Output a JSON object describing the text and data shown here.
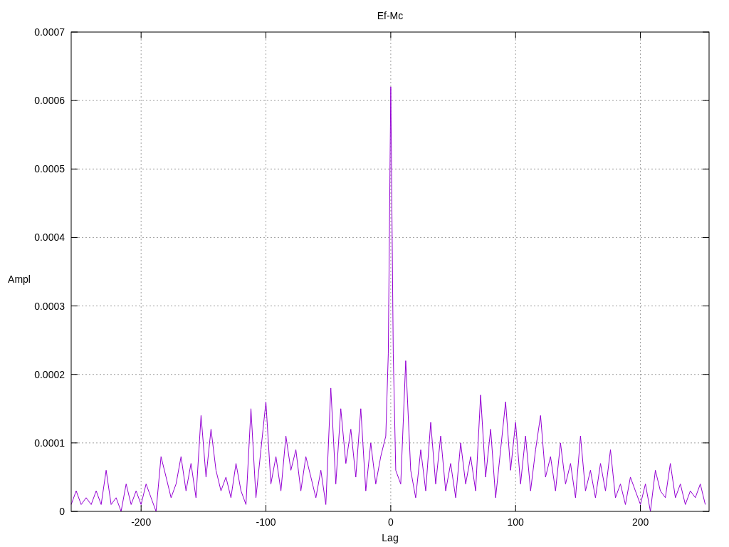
{
  "chart_data": {
    "type": "line",
    "title": "Ef-Mc",
    "xlabel": "Lag",
    "ylabel": "Ampl",
    "grid": true,
    "xlim": [
      -256,
      255
    ],
    "ylim": [
      0,
      0.0007
    ],
    "xticks": [
      -200,
      -100,
      0,
      100,
      200
    ],
    "yticks": [
      {
        "value": 0,
        "label": "0"
      },
      {
        "value": 0.0001,
        "label": "0.0001"
      },
      {
        "value": 0.0002,
        "label": "0.0002"
      },
      {
        "value": 0.0003,
        "label": "0.0003"
      },
      {
        "value": 0.0004,
        "label": "0.0004"
      },
      {
        "value": 0.0005,
        "label": "0.0005"
      },
      {
        "value": 0.0006,
        "label": "0.0006"
      },
      {
        "value": 0.0007,
        "label": "0.0007"
      }
    ],
    "x": [
      -256,
      -252,
      -248,
      -244,
      -240,
      -236,
      -232,
      -228,
      -224,
      -220,
      -216,
      -212,
      -208,
      -204,
      -200,
      -196,
      -192,
      -188,
      -184,
      -180,
      -176,
      -172,
      -168,
      -164,
      -160,
      -156,
      -152,
      -148,
      -144,
      -140,
      -136,
      -132,
      -128,
      -124,
      -120,
      -116,
      -112,
      -108,
      -104,
      -100,
      -96,
      -92,
      -88,
      -84,
      -80,
      -76,
      -72,
      -68,
      -64,
      -60,
      -56,
      -52,
      -48,
      -44,
      -40,
      -36,
      -32,
      -28,
      -24,
      -20,
      -16,
      -12,
      -8,
      -4,
      -2,
      0,
      2,
      4,
      8,
      12,
      16,
      20,
      24,
      28,
      32,
      36,
      40,
      44,
      48,
      52,
      56,
      60,
      64,
      68,
      72,
      76,
      80,
      84,
      88,
      92,
      96,
      100,
      104,
      108,
      112,
      116,
      120,
      124,
      128,
      132,
      136,
      140,
      144,
      148,
      152,
      156,
      160,
      164,
      168,
      172,
      176,
      180,
      184,
      188,
      192,
      196,
      200,
      204,
      208,
      212,
      216,
      220,
      224,
      228,
      232,
      236,
      240,
      244,
      248,
      252
    ],
    "series": [
      {
        "color": "#9400d3",
        "values": [
          1e-05,
          3e-05,
          1e-05,
          2e-05,
          1e-05,
          3e-05,
          1e-05,
          6e-05,
          1e-05,
          2e-05,
          0,
          4e-05,
          1e-05,
          3e-05,
          1e-05,
          4e-05,
          2e-05,
          0,
          8e-05,
          5e-05,
          2e-05,
          4e-05,
          8e-05,
          3e-05,
          7e-05,
          2e-05,
          0.00014,
          5e-05,
          0.00012,
          6e-05,
          3e-05,
          5e-05,
          2e-05,
          7e-05,
          3e-05,
          1e-05,
          0.00015,
          2e-05,
          9e-05,
          0.00016,
          4e-05,
          8e-05,
          3e-05,
          0.00011,
          6e-05,
          9e-05,
          3e-05,
          8e-05,
          5e-05,
          2e-05,
          6e-05,
          1e-05,
          0.00018,
          4e-05,
          0.00015,
          7e-05,
          0.00012,
          5e-05,
          0.00015,
          3e-05,
          0.0001,
          4e-05,
          8e-05,
          0.00011,
          0.00023,
          0.00062,
          0.00023,
          6e-05,
          4e-05,
          0.00022,
          6e-05,
          2e-05,
          9e-05,
          3e-05,
          0.00013,
          4e-05,
          0.00011,
          3e-05,
          7e-05,
          2e-05,
          0.0001,
          4e-05,
          8e-05,
          3e-05,
          0.00017,
          5e-05,
          0.00012,
          2e-05,
          9e-05,
          0.00016,
          6e-05,
          0.00013,
          4e-05,
          0.00011,
          3e-05,
          9e-05,
          0.00014,
          5e-05,
          8e-05,
          3e-05,
          0.0001,
          4e-05,
          7e-05,
          2e-05,
          0.00011,
          3e-05,
          6e-05,
          2e-05,
          7e-05,
          3e-05,
          9e-05,
          2e-05,
          4e-05,
          1e-05,
          5e-05,
          3e-05,
          1e-05,
          4e-05,
          0,
          6e-05,
          3e-05,
          2e-05,
          7e-05,
          2e-05,
          4e-05,
          1e-05,
          3e-05,
          2e-05,
          4e-05,
          1e-05
        ]
      }
    ]
  }
}
